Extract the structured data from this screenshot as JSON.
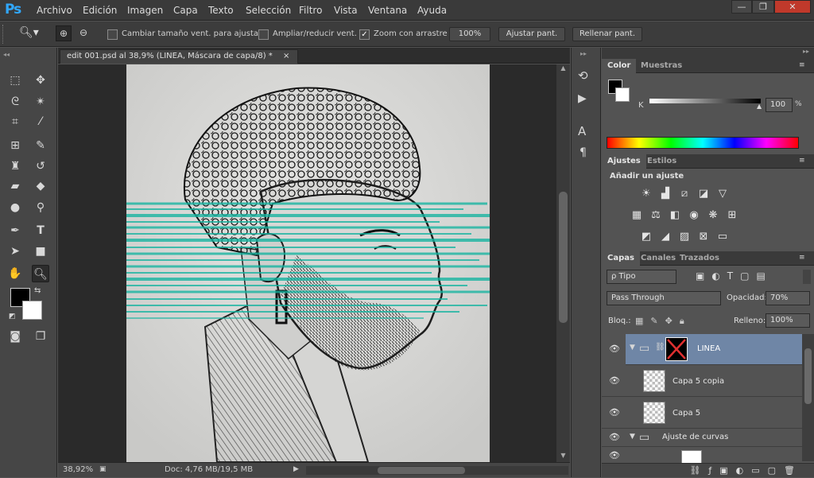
{
  "app": {
    "logo": "Ps",
    "menu": [
      "Archivo",
      "Edición",
      "Imagen",
      "Capa",
      "Texto",
      "Selección",
      "Filtro",
      "Vista",
      "Ventana",
      "Ayuda"
    ],
    "window_controls": [
      "—",
      "❐",
      "✕"
    ]
  },
  "options": {
    "zoom_icon": "zoom-icon",
    "cb1": "Cambiar tamaño vent. para ajustar",
    "cb2": "Ampliar/reducir vent.",
    "cb3": "Zoom con arrastre",
    "zoom_value": "100%",
    "fit_btn": "Ajustar pant.",
    "fill_btn": "Rellenar pant."
  },
  "document": {
    "tab_title": "edit 001.psd al 38,9% (LINEA, Máscara de capa/8)",
    "tab_modified": "*",
    "tab_close": "×"
  },
  "status": {
    "zoom": "38,92%",
    "doc": "Doc: 4,76 MB/19,5 MB"
  },
  "color": {
    "tab_color": "Color",
    "tab_swatches": "Muestras",
    "channel": "K",
    "value": "100",
    "fg": "#000000",
    "bg": "#ffffff"
  },
  "adjust": {
    "tab_adjust": "Ajustes",
    "tab_styles": "Estilos",
    "title": "Añadir un ajuste"
  },
  "layers": {
    "tab_layers": "Capas",
    "tab_channels": "Canales",
    "tab_paths": "Trazados",
    "filter": "ρ Tipo",
    "blend": "Pass Through",
    "opacity_label": "Opacidad:",
    "opacity": "70%",
    "lock_label": "Bloq.:",
    "fill_label": "Relleno:",
    "fill": "100%",
    "rows": [
      {
        "name": "LINEA"
      },
      {
        "name": "Capa 5 copia"
      },
      {
        "name": "Capa 5"
      },
      {
        "name": "Ajuste de curvas"
      }
    ]
  },
  "accent": "#31a8ff",
  "teal": "#14b4a0"
}
